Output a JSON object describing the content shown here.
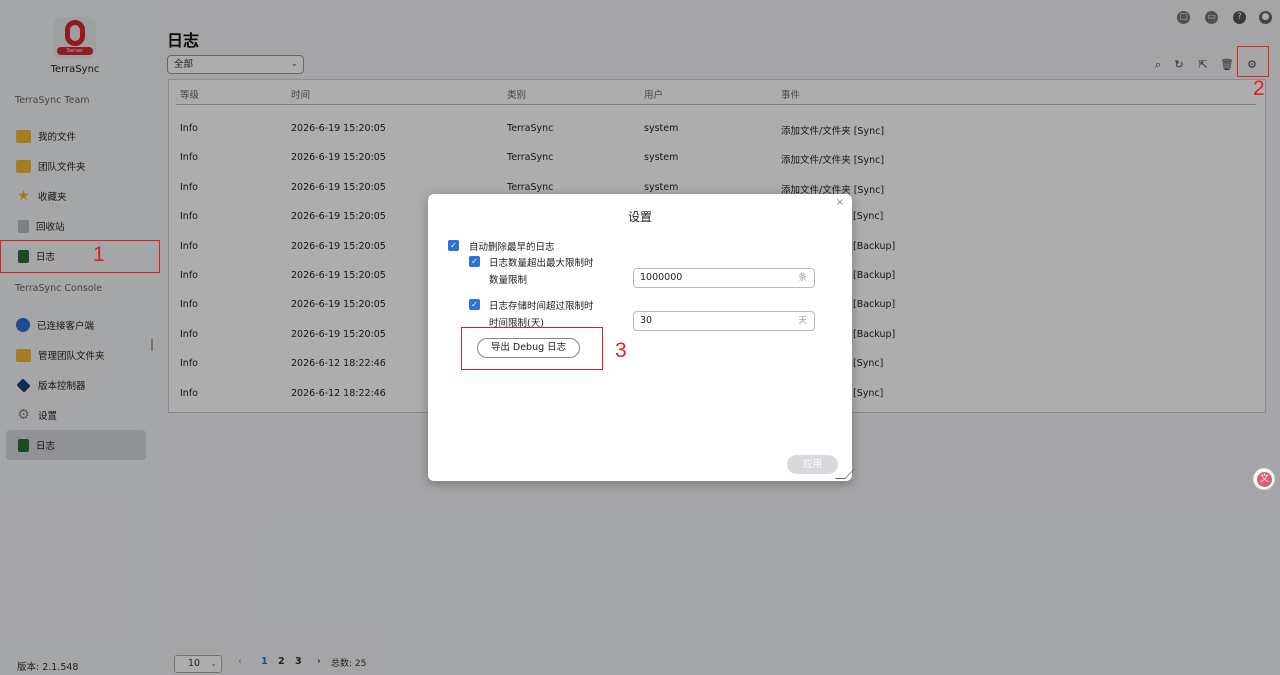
{
  "app": {
    "name": "TerraSync",
    "logo_text": "Server",
    "version_label": "版本: 2.1.548"
  },
  "sidebar": {
    "team_section": "TerraSync Team",
    "team_items": [
      {
        "label": "我的文件",
        "icon": "folder-icon"
      },
      {
        "label": "团队文件夹",
        "icon": "team-folder-icon"
      },
      {
        "label": "收藏夹",
        "icon": "star-icon"
      },
      {
        "label": "回收站",
        "icon": "recycle-bin-icon"
      },
      {
        "label": "日志",
        "icon": "log-icon"
      }
    ],
    "console_section": "TerraSync Console",
    "console_items": [
      {
        "label": "已连接客户端",
        "icon": "link-icon"
      },
      {
        "label": "管理团队文件夹",
        "icon": "team-folder-icon"
      },
      {
        "label": "版本控制器",
        "icon": "cube-icon"
      },
      {
        "label": "设置",
        "icon": "gear-icon"
      },
      {
        "label": "日志",
        "icon": "log-icon",
        "active": true
      }
    ]
  },
  "main": {
    "title": "日志",
    "filter_value": "全部",
    "toolbar_icons": [
      "search-icon",
      "refresh-icon",
      "export-icon",
      "delete-icon",
      "settings-icon"
    ],
    "columns": [
      "等级",
      "时间",
      "类别",
      "用户",
      "事件"
    ],
    "rows": [
      {
        "level": "Info",
        "time": "2026-6-19 15:20:05",
        "category": "TerraSync",
        "user": "system",
        "event": "添加文件/文件夹 [Sync]"
      },
      {
        "level": "Info",
        "time": "2026-6-19 15:20:05",
        "category": "TerraSync",
        "user": "system",
        "event": "添加文件/文件夹 [Sync]"
      },
      {
        "level": "Info",
        "time": "2026-6-19 15:20:05",
        "category": "TerraSync",
        "user": "system",
        "event": "添加文件/文件夹 [Sync]"
      },
      {
        "level": "Info",
        "time": "2026-6-19 15:20:05",
        "category": "",
        "user": "",
        "event": "[Sync]"
      },
      {
        "level": "Info",
        "time": "2026-6-19 15:20:05",
        "category": "",
        "user": "",
        "event": "[Backup]"
      },
      {
        "level": "Info",
        "time": "2026-6-19 15:20:05",
        "category": "",
        "user": "",
        "event": "[Backup]"
      },
      {
        "level": "Info",
        "time": "2026-6-19 15:20:05",
        "category": "",
        "user": "",
        "event": "[Backup]"
      },
      {
        "level": "Info",
        "time": "2026-6-19 15:20:05",
        "category": "",
        "user": "",
        "event": "[Backup]"
      },
      {
        "level": "Info",
        "time": "2026-6-12 18:22:46",
        "category": "",
        "user": "",
        "event": "[Sync]"
      },
      {
        "level": "Info",
        "time": "2026-6-12 18:22:46",
        "category": "",
        "user": "",
        "event": "[Sync]"
      }
    ]
  },
  "pagination": {
    "page_size": "10",
    "pages": [
      "1",
      "2",
      "3"
    ],
    "current_page": "1",
    "total_label": "总数: 25"
  },
  "dialog": {
    "title": "设置",
    "auto_delete_label": "自动删除最早的日志",
    "count_exceed_label": "日志数量超出最大限制时",
    "count_limit_label": "数量限制",
    "count_limit_value": "1000000",
    "count_unit": "条",
    "time_exceed_label": "日志存储时间超过限制时",
    "time_limit_label": "时间限制(天)",
    "time_limit_value": "30",
    "time_unit": "天",
    "export_button": "导出 Debug 日志",
    "apply_button": "应用"
  },
  "annotations": [
    "1",
    "2",
    "3"
  ],
  "colors": {
    "accent": "#2e6fd8",
    "annotation": "#e02020"
  }
}
